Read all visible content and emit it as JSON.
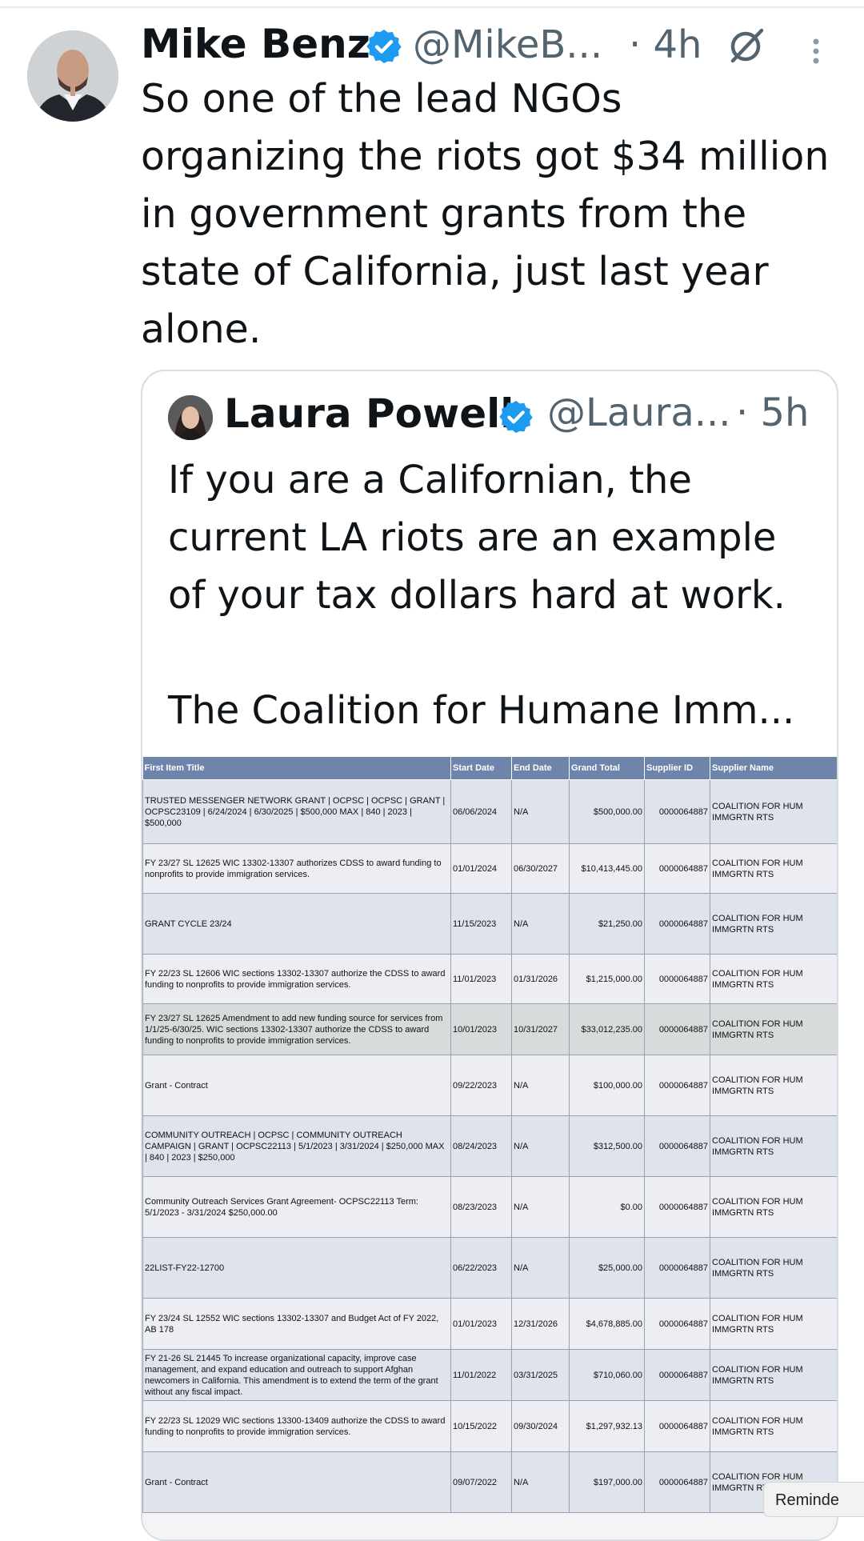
{
  "tweet": {
    "author_name": "Mike Benz",
    "handle": "@MikeB...",
    "time": "· 4h",
    "text_lines": [
      "So one of the lead NGOs",
      "organizing the riots got $34 million",
      "in government grants from the",
      "state of California, just last year",
      "alone."
    ]
  },
  "quote": {
    "author_name": "Laura Powell",
    "handle": "@Laura...",
    "time": "· 5h",
    "text_lines": [
      "If you are a Californian, the",
      "current LA riots are an example",
      "of your tax dollars hard at work.",
      "",
      "The Coalition for Humane Imm..."
    ]
  },
  "table": {
    "headers": [
      "First Item Title",
      "Start Date",
      "End Date",
      "Grand Total",
      "Supplier ID",
      "Supplier Name"
    ],
    "rows": [
      [
        "TRUSTED MESSENGER NETWORK GRANT | OCPSC | OCPSC | GRANT | OCPSC23109 | 6/24/2024 | 6/30/2025 | $500,000 MAX | 840 | 2023 | $500,000",
        "06/06/2024",
        "N/A",
        "$500,000.00",
        "0000064887",
        "COALITION FOR HUM IMMGRTN RTS"
      ],
      [
        "FY 23/27 SL 12625 WIC 13302-13307 authorizes CDSS to award funding to nonprofits to provide immigration services.",
        "01/01/2024",
        "06/30/2027",
        "$10,413,445.00",
        "0000064887",
        "COALITION FOR HUM IMMGRTN RTS"
      ],
      [
        "GRANT CYCLE 23/24",
        "11/15/2023",
        "N/A",
        "$21,250.00",
        "0000064887",
        "COALITION FOR HUM IMMGRTN RTS"
      ],
      [
        "FY 22/23 SL 12606 WIC sections 13302-13307 authorize the CDSS to award funding to nonprofits to provide immigration services.",
        "11/01/2023",
        "01/31/2026",
        "$1,215,000.00",
        "0000064887",
        "COALITION FOR HUM IMMGRTN RTS"
      ],
      [
        "FY 23/27 SL 12625 Amendment to add new funding source for services from 1/1/25-6/30/25. WIC sections 13302-13307 authorize the CDSS to award funding to nonprofits to provide immigration services.",
        "10/01/2023",
        "10/31/2027",
        "$33,012,235.00",
        "0000064887",
        "COALITION FOR HUM IMMGRTN RTS"
      ],
      [
        "Grant - Contract",
        "09/22/2023",
        "N/A",
        "$100,000.00",
        "0000064887",
        "COALITION FOR HUM IMMGRTN RTS"
      ],
      [
        "COMMUNITY OUTREACH | OCPSC | COMMUNITY OUTREACH CAMPAIGN | GRANT | OCPSC22113 | 5/1/2023 | 3/31/2024 | $250,000 MAX | 840 | 2023 | $250,000",
        "08/24/2023",
        "N/A",
        "$312,500.00",
        "0000064887",
        "COALITION FOR HUM IMMGRTN RTS"
      ],
      [
        "Community Outreach Services Grant Agreement- OCPSC22113 Term: 5/1/2023 - 3/31/2024 $250,000.00",
        "08/23/2023",
        "N/A",
        "$0.00",
        "0000064887",
        "COALITION FOR HUM IMMGRTN RTS"
      ],
      [
        "22LIST-FY22-12700",
        "06/22/2023",
        "N/A",
        "$25,000.00",
        "0000064887",
        "COALITION FOR HUM IMMGRTN RTS"
      ],
      [
        "FY 23/24 SL 12552 WIC sections 13302-13307 and Budget Act of FY 2022, AB 178",
        "01/01/2023",
        "12/31/2026",
        "$4,678,885.00",
        "0000064887",
        "COALITION FOR HUM IMMGRTN RTS"
      ],
      [
        "FY 21-26 SL 21445 To increase organizational capacity, improve case management, and expand education and outreach to support Afghan newcomers in California. This amendment is to extend the term of the grant without any fiscal impact.",
        "11/01/2022",
        "03/31/2025",
        "$710,060.00",
        "0000064887",
        "COALITION FOR HUM IMMGRTN RTS"
      ],
      [
        "FY 22/23 SL 12029 WIC sections 13300-13409 authorize the CDSS to award funding to nonprofits to provide immigration services.",
        "10/15/2022",
        "09/30/2024",
        "$1,297,932.13",
        "0000064887",
        "COALITION FOR HUM IMMGRTN RTS"
      ],
      [
        "Grant - Contract",
        "09/07/2022",
        "N/A",
        "$197,000.00",
        "0000064887",
        "COALITION FOR HUM IMMGRTN RTS"
      ]
    ]
  },
  "reminder_label": "Reminde",
  "colors": {
    "verified": "#1d9bf0",
    "header_bg": "#6f84ab",
    "secondary_text": "#536471"
  }
}
